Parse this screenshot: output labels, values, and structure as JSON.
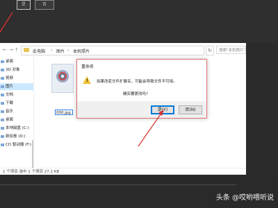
{
  "top": {
    "btn1": "是",
    "btn2": "否"
  },
  "explorer": {
    "breadcrumb": [
      "此电脑",
      "图片",
      "本机照片"
    ],
    "search_placeholder": "搜索\"本机照片\"",
    "nav_items": [
      {
        "label": "桌面",
        "selected": false
      },
      {
        "label": "3D 对象",
        "selected": false
      },
      {
        "label": "视频",
        "selected": false
      },
      {
        "label": "图片",
        "selected": true
      },
      {
        "label": "文档",
        "selected": false
      },
      {
        "label": "下载",
        "selected": false
      },
      {
        "label": "音乐",
        "selected": false
      },
      {
        "label": "桌面",
        "selected": false
      },
      {
        "label": "本地磁盘 (C:)",
        "selected": false
      },
      {
        "label": "新加卷 (D:)",
        "selected": false
      },
      {
        "label": "CD 驱动器 (F:)",
        "selected": false
      }
    ],
    "file_name": "000.jpg",
    "status": "1 个项目  选中 1 个项目  27.2 KB"
  },
  "dialog": {
    "title": "重命名",
    "message": "如果改变文件扩展名，可能会导致文件不可用。",
    "question": "确实要更改吗?",
    "yes": "是(Y)",
    "no": "否(N)"
  },
  "watermark": "头条 @哎哟喂听说",
  "colors": {
    "accent": "#0078d7",
    "arrow": "#d0312d",
    "warning": "#f2c230"
  }
}
